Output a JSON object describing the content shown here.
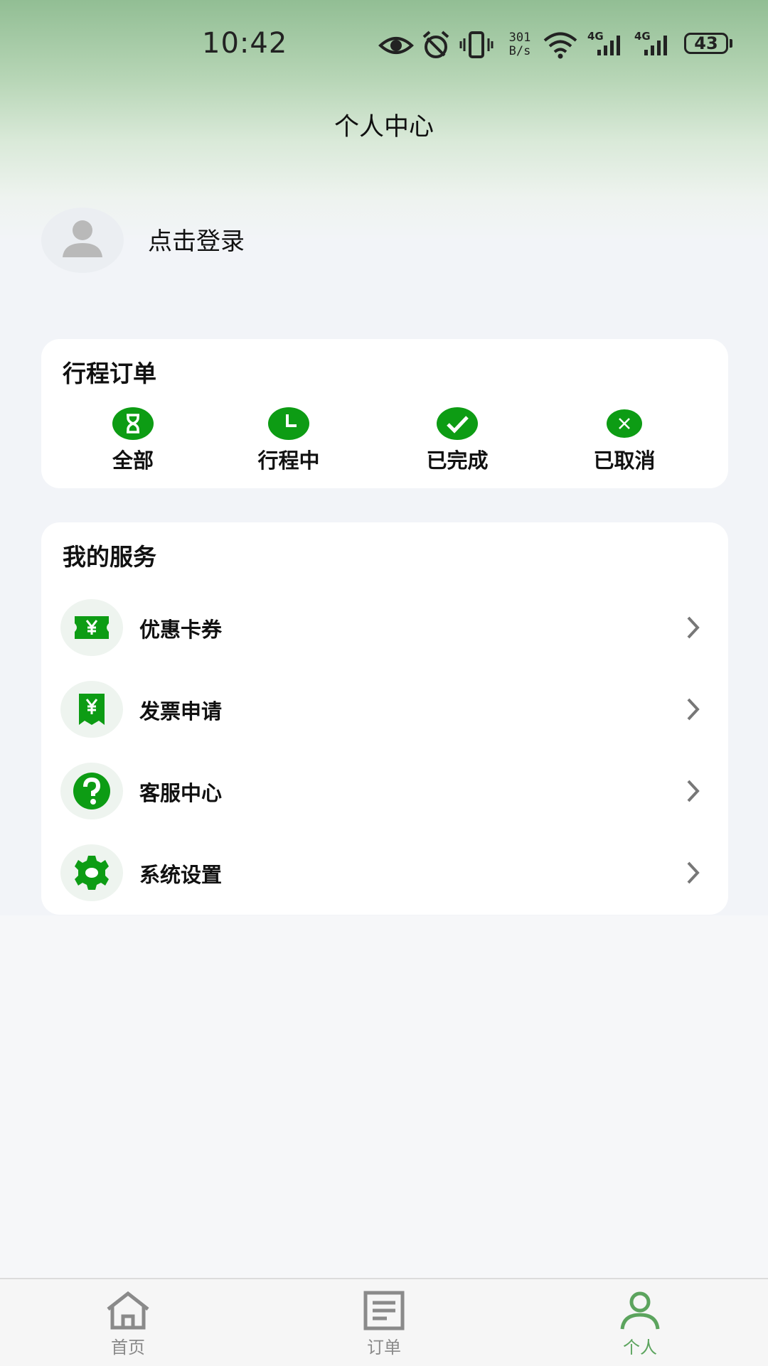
{
  "status_bar": {
    "time": "10:42",
    "net_speed_value": "301",
    "net_speed_unit": "B/s",
    "network_1": "4G",
    "network_2": "4G",
    "battery_level": "43",
    "icons": [
      "eye-icon",
      "alarm-icon",
      "vibrate-icon",
      "wifi-icon",
      "signal-icon",
      "signal-icon",
      "battery-icon"
    ]
  },
  "header": {
    "title": "个人中心"
  },
  "profile": {
    "login_label": "点击登录",
    "avatar_icon": "user-placeholder-icon"
  },
  "trip_orders": {
    "title": "行程订单",
    "items": [
      {
        "label": "全部",
        "icon": "hourglass-icon"
      },
      {
        "label": "行程中",
        "icon": "clock-icon"
      },
      {
        "label": "已完成",
        "icon": "check-icon"
      },
      {
        "label": "已取消",
        "icon": "cancel-icon"
      }
    ]
  },
  "services": {
    "title": "我的服务",
    "items": [
      {
        "label": "优惠卡券",
        "icon": "coupon-icon"
      },
      {
        "label": "发票申请",
        "icon": "invoice-icon"
      },
      {
        "label": "客服中心",
        "icon": "help-icon"
      },
      {
        "label": "系统设置",
        "icon": "gear-icon"
      }
    ]
  },
  "bottom_nav": {
    "items": [
      {
        "label": "首页",
        "icon": "home-icon",
        "active": false
      },
      {
        "label": "订单",
        "icon": "document-icon",
        "active": false
      },
      {
        "label": "个人",
        "icon": "person-icon",
        "active": true
      }
    ]
  },
  "colors": {
    "accent_green": "#0d9c14",
    "active_tab": "#5ca45e",
    "header_gradient_top": "#92be94",
    "background": "#f2f4f8"
  }
}
